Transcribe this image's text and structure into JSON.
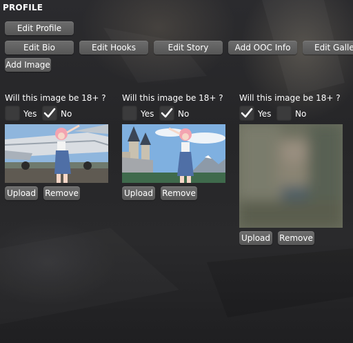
{
  "header": {
    "title": "PROFILE"
  },
  "toolbar": {
    "edit_profile": "Edit Profile",
    "edit_bio": "Edit Bio",
    "edit_hooks": "Edit Hooks",
    "edit_story": "Edit Story",
    "add_ooc_info": "Add OOC Info",
    "edit_gallery": "Edit Gallery",
    "add_image": "Add Image"
  },
  "gallery": {
    "question": "Will this image be 18+ ?",
    "yes_label": "Yes",
    "no_label": "No",
    "upload_label": "Upload",
    "remove_label": "Remove",
    "images": [
      {
        "adult": false,
        "blurred": false,
        "scene": "airplane"
      },
      {
        "adult": false,
        "blurred": false,
        "scene": "castle"
      },
      {
        "adult": true,
        "blurred": true,
        "scene": "blurred"
      }
    ]
  },
  "colors": {
    "button": "#5f5f5f",
    "checkbox": "#3b3b3c",
    "text": "#ffffff"
  }
}
